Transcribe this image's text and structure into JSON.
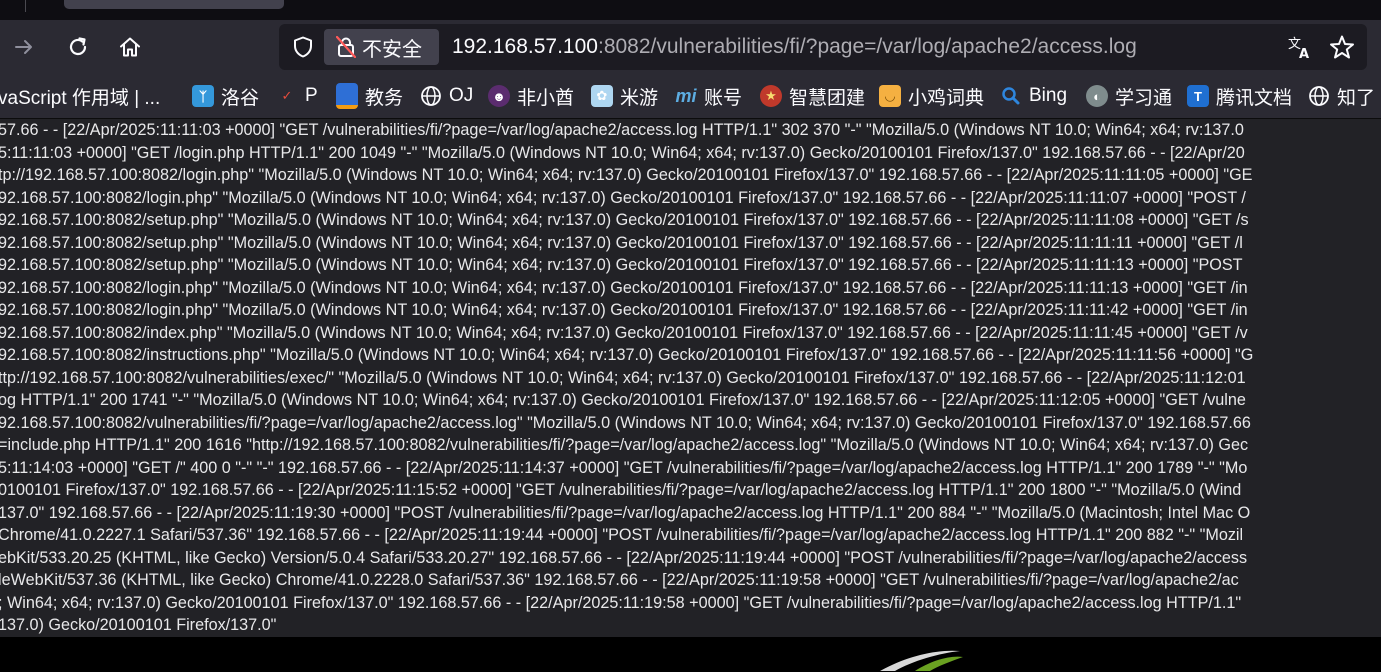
{
  "url": {
    "security_label": "不安全",
    "host": "192.168.57.100",
    "path": ":8082/vulnerabilities/fi/?page=/var/log/apache2/access.log"
  },
  "bookmarks": [
    {
      "label": "vaScript 作用域 | ...",
      "icon": "none"
    },
    {
      "label": "洛谷",
      "icon": "luogu-icon",
      "color": "#3498db"
    },
    {
      "label": "P",
      "icon": "p-icon",
      "color": "#e74c3c"
    },
    {
      "label": "教务",
      "icon": "jiaowu-icon",
      "color": "#f39c12"
    },
    {
      "label": "OJ",
      "icon": "globe-icon"
    },
    {
      "label": "非小酋",
      "icon": "fxq-icon",
      "color": "#8e44ad"
    },
    {
      "label": "米游",
      "icon": "miyou-icon",
      "color": "#85c1e9"
    },
    {
      "label": "账号",
      "icon": "mi-icon",
      "color": "#5dade2"
    },
    {
      "label": "智慧团建",
      "icon": "tuanjian-icon",
      "color": "#e74c3c"
    },
    {
      "label": "小鸡词典",
      "icon": "chick-icon",
      "color": "#f5b041"
    },
    {
      "label": "Bing",
      "icon": "search-icon",
      "color": "#2e86de"
    },
    {
      "label": "学习通",
      "icon": "xuexitong-icon",
      "color": "#95a5a6"
    },
    {
      "label": "腾讯文档",
      "icon": "tencent-docs-icon",
      "color": "#2e86de"
    },
    {
      "label": "知了",
      "icon": "globe-icon"
    }
  ],
  "log_lines": [
    "57.66 - - [22/Apr/2025:11:11:03 +0000] \"GET /vulnerabilities/fi/?page=/var/log/apache2/access.log HTTP/1.1\" 302 370 \"-\" \"Mozilla/5.0 (Windows NT 10.0; Win64; x64; rv:137.0",
    "5:11:11:03 +0000] \"GET /login.php HTTP/1.1\" 200 1049 \"-\" \"Mozilla/5.0 (Windows NT 10.0; Win64; x64; rv:137.0) Gecko/20100101 Firefox/137.0\" 192.168.57.66 - - [22/Apr/20",
    "tp://192.168.57.100:8082/login.php\" \"Mozilla/5.0 (Windows NT 10.0; Win64; x64; rv:137.0) Gecko/20100101 Firefox/137.0\" 192.168.57.66 - - [22/Apr/2025:11:11:05 +0000] \"GE",
    "92.168.57.100:8082/login.php\" \"Mozilla/5.0 (Windows NT 10.0; Win64; x64; rv:137.0) Gecko/20100101 Firefox/137.0\" 192.168.57.66 - - [22/Apr/2025:11:11:07 +0000] \"POST /",
    "92.168.57.100:8082/setup.php\" \"Mozilla/5.0 (Windows NT 10.0; Win64; x64; rv:137.0) Gecko/20100101 Firefox/137.0\" 192.168.57.66 - - [22/Apr/2025:11:11:08 +0000] \"GET /s",
    "92.168.57.100:8082/setup.php\" \"Mozilla/5.0 (Windows NT 10.0; Win64; x64; rv:137.0) Gecko/20100101 Firefox/137.0\" 192.168.57.66 - - [22/Apr/2025:11:11:11 +0000] \"GET /l",
    "92.168.57.100:8082/setup.php\" \"Mozilla/5.0 (Windows NT 10.0; Win64; x64; rv:137.0) Gecko/20100101 Firefox/137.0\" 192.168.57.66 - - [22/Apr/2025:11:11:13 +0000] \"POST",
    "92.168.57.100:8082/login.php\" \"Mozilla/5.0 (Windows NT 10.0; Win64; x64; rv:137.0) Gecko/20100101 Firefox/137.0\" 192.168.57.66 - - [22/Apr/2025:11:11:13 +0000] \"GET /in",
    "92.168.57.100:8082/login.php\" \"Mozilla/5.0 (Windows NT 10.0; Win64; x64; rv:137.0) Gecko/20100101 Firefox/137.0\" 192.168.57.66 - - [22/Apr/2025:11:11:42 +0000] \"GET /in",
    "92.168.57.100:8082/index.php\" \"Mozilla/5.0 (Windows NT 10.0; Win64; x64; rv:137.0) Gecko/20100101 Firefox/137.0\" 192.168.57.66 - - [22/Apr/2025:11:11:45 +0000] \"GET /v",
    "92.168.57.100:8082/instructions.php\" \"Mozilla/5.0 (Windows NT 10.0; Win64; x64; rv:137.0) Gecko/20100101 Firefox/137.0\" 192.168.57.66 - - [22/Apr/2025:11:11:56 +0000] \"G",
    "ttp://192.168.57.100:8082/vulnerabilities/exec/\" \"Mozilla/5.0 (Windows NT 10.0; Win64; x64; rv:137.0) Gecko/20100101 Firefox/137.0\" 192.168.57.66 - - [22/Apr/2025:11:12:01",
    "og HTTP/1.1\" 200 1741 \"-\" \"Mozilla/5.0 (Windows NT 10.0; Win64; x64; rv:137.0) Gecko/20100101 Firefox/137.0\" 192.168.57.66 - - [22/Apr/2025:11:12:05 +0000] \"GET /vulne",
    "92.168.57.100:8082/vulnerabilities/fi/?page=/var/log/apache2/access.log\" \"Mozilla/5.0 (Windows NT 10.0; Win64; x64; rv:137.0) Gecko/20100101 Firefox/137.0\" 192.168.57.66",
    "=include.php HTTP/1.1\" 200 1616 \"http://192.168.57.100:8082/vulnerabilities/fi/?page=/var/log/apache2/access.log\" \"Mozilla/5.0 (Windows NT 10.0; Win64; x64; rv:137.0) Gec",
    "5:11:14:03 +0000] \"GET /\" 400 0 \"-\" \"-\" 192.168.57.66 - - [22/Apr/2025:11:14:37 +0000] \"GET /vulnerabilities/fi/?page=/var/log/apache2/access.log HTTP/1.1\" 200 1789 \"-\" \"Mo",
    "0100101 Firefox/137.0\" 192.168.57.66 - - [22/Apr/2025:11:15:52 +0000] \"GET /vulnerabilities/fi/?page=/var/log/apache2/access.log HTTP/1.1\" 200 1800 \"-\" \"Mozilla/5.0 (Wind",
    "137.0\" 192.168.57.66 - - [22/Apr/2025:11:19:30 +0000] \"POST /vulnerabilities/fi/?page=/var/log/apache2/access.log HTTP/1.1\" 200 884 \"-\" \"Mozilla/5.0 (Macintosh; Intel Mac O",
    "Chrome/41.0.2227.1 Safari/537.36\" 192.168.57.66 - - [22/Apr/2025:11:19:44 +0000] \"POST /vulnerabilities/fi/?page=/var/log/apache2/access.log HTTP/1.1\" 200 882 \"-\" \"Mozil",
    "ebKit/533.20.25 (KHTML, like Gecko) Version/5.0.4 Safari/533.20.27\" 192.168.57.66 - - [22/Apr/2025:11:19:44 +0000] \"POST /vulnerabilities/fi/?page=/var/log/apache2/access",
    "leWebKit/537.36 (KHTML, like Gecko) Chrome/41.0.2228.0 Safari/537.36\" 192.168.57.66 - - [22/Apr/2025:11:19:58 +0000] \"GET /vulnerabilities/fi/?page=/var/log/apache2/ac",
    "; Win64; x64; rv:137.0) Gecko/20100101 Firefox/137.0\" 192.168.57.66 - - [22/Apr/2025:11:19:58 +0000] \"GET /vulnerabilities/fi/?page=/var/log/apache2/access.log HTTP/1.1\"",
    "137.0) Gecko/20100101 Firefox/137.0\""
  ],
  "colors": {
    "toolbar": "#2b2a33",
    "urlbar": "#1c1b22",
    "content_bg": "#222226",
    "text": "#e8e8ea"
  }
}
